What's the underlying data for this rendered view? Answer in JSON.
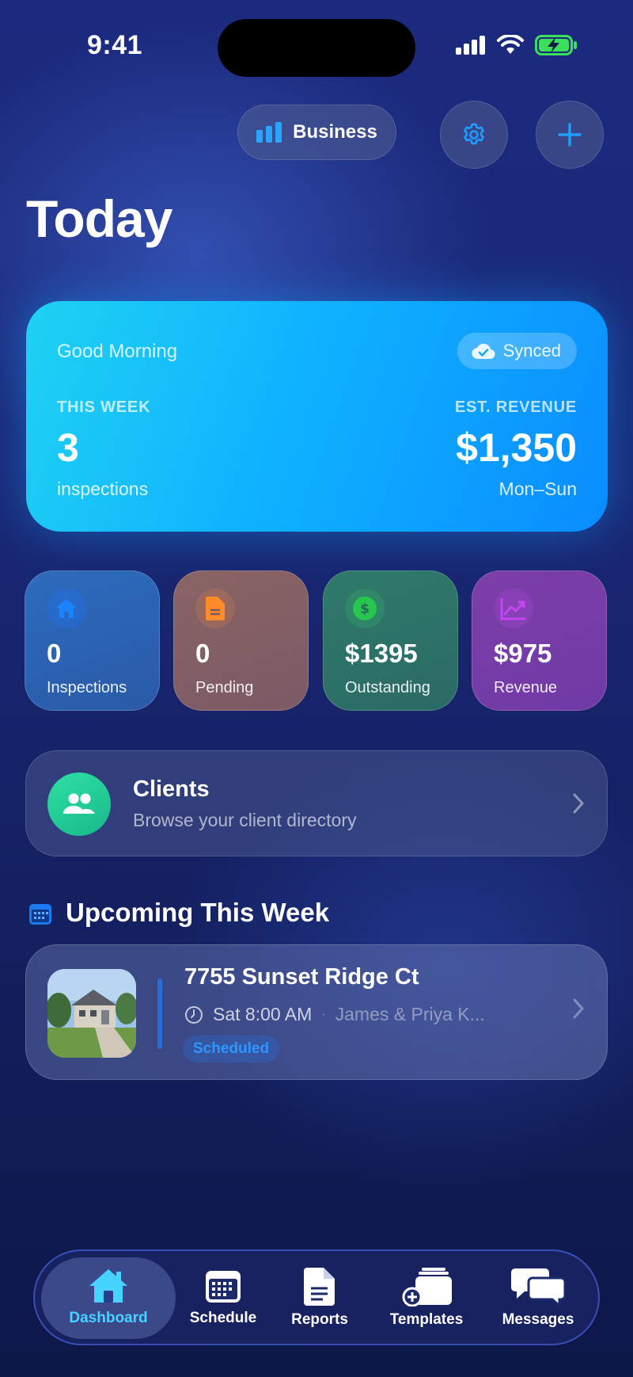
{
  "status_bar": {
    "time": "9:41"
  },
  "header": {
    "mode_button_label": "Business",
    "settings_icon": "gear-icon",
    "add_icon": "plus-icon",
    "title": "Today"
  },
  "summary_card": {
    "greeting": "Good Morning",
    "sync_status": "Synced",
    "left_label": "THIS WEEK",
    "left_value": "3",
    "left_sub": "inspections",
    "right_label": "EST. REVENUE",
    "right_value": "$1,350",
    "right_sub": "Mon–Sun",
    "colors": {
      "start": "#1fd2f2",
      "end": "#0a8dff"
    }
  },
  "stats": [
    {
      "icon": "house-icon",
      "value": "0",
      "label": "Inspections",
      "color": "#1a84ff"
    },
    {
      "icon": "document-icon",
      "value": "0",
      "label": "Pending",
      "color": "#ff8a2a"
    },
    {
      "icon": "dollar-icon",
      "value": "$1395",
      "label": "Outstanding",
      "color": "#26c74f"
    },
    {
      "icon": "chart-trend-icon",
      "value": "$975",
      "label": "Revenue",
      "color": "#c646f2"
    }
  ],
  "clients_card": {
    "icon": "people-icon",
    "title": "Clients",
    "subtitle": "Browse your client directory"
  },
  "upcoming": {
    "heading": "Upcoming This Week",
    "items": [
      {
        "address": "7755 Sunset Ridge Ct",
        "time": "Sat 8:00 AM",
        "separator": "·",
        "client": "James & Priya K...",
        "status": "Scheduled"
      }
    ]
  },
  "tab_bar": {
    "active_color": "#46d3ff",
    "tabs": [
      {
        "label": "Dashboard",
        "icon": "house-icon",
        "active": true
      },
      {
        "label": "Schedule",
        "icon": "calendar-icon",
        "active": false
      },
      {
        "label": "Reports",
        "icon": "document-icon",
        "active": false
      },
      {
        "label": "Templates",
        "icon": "templates-stack-icon",
        "active": false
      },
      {
        "label": "Messages",
        "icon": "chat-bubbles-icon",
        "active": false
      }
    ]
  }
}
